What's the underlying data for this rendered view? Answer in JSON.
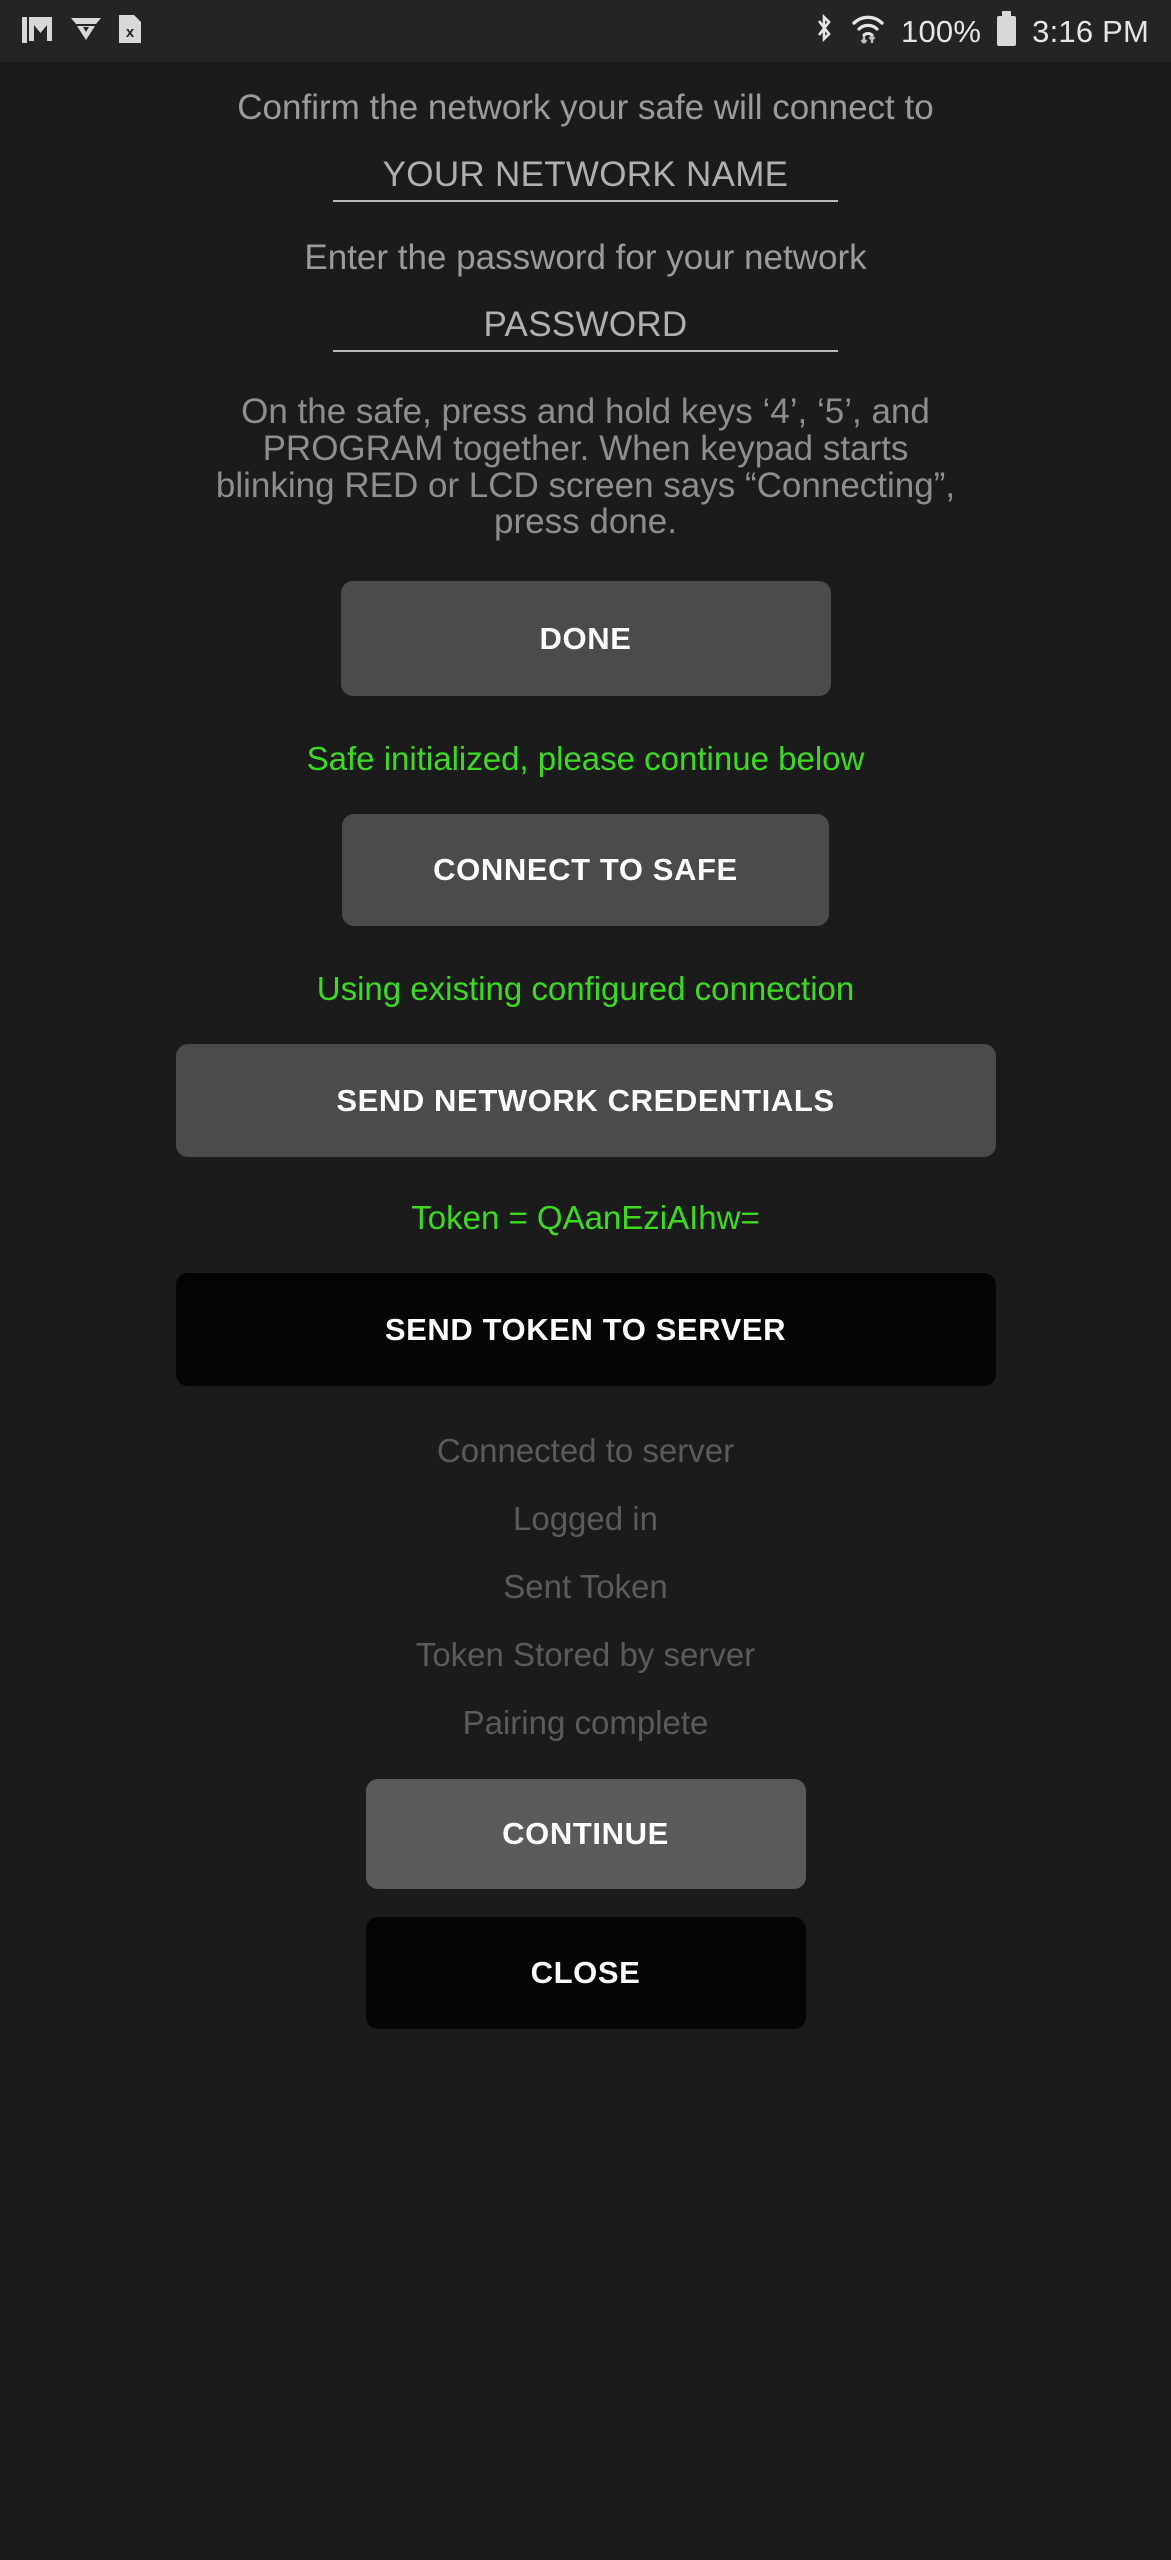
{
  "statusbar": {
    "left_icons": [
      "gmail-icon",
      "vector-app-icon",
      "x-document-icon"
    ],
    "right_icons": [
      "bluetooth-icon",
      "wifi-icon",
      "battery-icon"
    ],
    "battery_percent": "100%",
    "time": "3:16 PM"
  },
  "main": {
    "network_prompt": "Confirm the network your safe will connect to",
    "network_field_value": "YOUR NETWORK NAME",
    "password_prompt": "Enter the password for your network",
    "password_field_value": "PASSWORD",
    "instructions": "On the safe, press and hold keys ‘4’, ‘5’, and PROGRAM together. When keypad starts blinking RED or LCD screen says “Connecting”, press done.",
    "done_button": "DONE",
    "status_safe_initialized": "Safe initialized, please continue below",
    "connect_button": "CONNECT TO SAFE",
    "status_existing_connection": "Using existing configured connection",
    "send_credentials_button": "SEND NETWORK CREDENTIALS",
    "status_token": "Token = QAanEziAIhw=",
    "send_token_button": "SEND TOKEN TO SERVER",
    "log": [
      "Connected to server",
      "Logged in",
      "Sent Token",
      "Token Stored by server",
      "Pairing complete"
    ],
    "continue_button": "CONTINUE",
    "close_button": "CLOSE"
  },
  "colors": {
    "background": "#1b1b1b",
    "statusbar_bg": "#242424",
    "accent_green": "#3ddb20",
    "dim_text": "#5b5b5b",
    "prompt_text": "#9b9b9b",
    "button_gray": "#4b4b4b",
    "button_gray_light": "#5a5a5a",
    "button_black": "#050505"
  }
}
